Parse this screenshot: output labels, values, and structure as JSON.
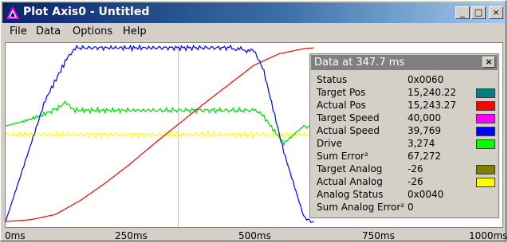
{
  "window": {
    "title": "Plot Axis0 - Untitled",
    "controls": {
      "minimize": "_",
      "maximize": "□",
      "close": "×"
    }
  },
  "menu": {
    "items": [
      "File",
      "Data",
      "Options",
      "Help"
    ]
  },
  "plot": {
    "x_ticks": [
      "0ms",
      "250ms",
      "500ms",
      "750ms",
      "1000ms"
    ],
    "cursor_ms": 347.7,
    "chart_data": {
      "type": "line",
      "x_unit": "ms",
      "xlim": [
        0,
        1000
      ],
      "grid": false,
      "series": [
        {
          "name": "Actual Pos",
          "color": "#ff0000",
          "x": [
            0,
            50,
            100,
            150,
            200,
            250,
            300,
            347.7,
            400,
            450,
            500,
            550,
            600,
            620
          ],
          "y": [
            0.0,
            0.01,
            0.04,
            0.12,
            0.22,
            0.33,
            0.45,
            0.56,
            0.68,
            0.79,
            0.9,
            0.965,
            0.995,
            1.0
          ]
        },
        {
          "name": "Actual Speed",
          "color": "#0000ff",
          "x": [
            0,
            40,
            80,
            120,
            140,
            200,
            300,
            450,
            500,
            520,
            560,
            600,
            620
          ],
          "y": [
            0,
            0.35,
            0.7,
            0.92,
            1.0,
            1.0,
            1.0,
            1.0,
            0.98,
            0.86,
            0.4,
            0.03,
            0
          ]
        },
        {
          "name": "Drive",
          "color": "#00dd00",
          "x": [
            0,
            40,
            80,
            110,
            120,
            140,
            300,
            500,
            520,
            560,
            600,
            620
          ],
          "y": [
            0.55,
            0.58,
            0.62,
            0.66,
            0.68,
            0.64,
            0.64,
            0.64,
            0.6,
            0.45,
            0.55,
            0.55
          ]
        },
        {
          "name": "Actual Analog",
          "color": "#ffff00",
          "x": [
            0,
            620
          ],
          "y": [
            0.5,
            0.5
          ]
        }
      ]
    }
  },
  "data_panel": {
    "title": "Data at 347.7 ms",
    "close": "×",
    "rows": [
      {
        "label": "Status",
        "value": "0x0060",
        "color": ""
      },
      {
        "label": "Target Pos",
        "value": "15,240.22",
        "color": "#008080"
      },
      {
        "label": "Actual Pos",
        "value": "15,243.27",
        "color": "#ff0000"
      },
      {
        "label": "Target Speed",
        "value": "40,000",
        "color": "#ff00ff"
      },
      {
        "label": "Actual Speed",
        "value": "39,769",
        "color": "#0000ff"
      },
      {
        "label": "Drive",
        "value": "3,274",
        "color": "#00ff00"
      },
      {
        "label": "Sum Error²",
        "value": "67,272",
        "color": ""
      },
      {
        "label": "Target Analog",
        "value": "-26",
        "color": "#808000"
      },
      {
        "label": "Actual Analog",
        "value": "-26",
        "color": "#ffff00"
      },
      {
        "label": "Analog Status",
        "value": "0x0040",
        "color": ""
      },
      {
        "label": "Sum Analog Error²",
        "value": "0",
        "color": ""
      }
    ]
  }
}
